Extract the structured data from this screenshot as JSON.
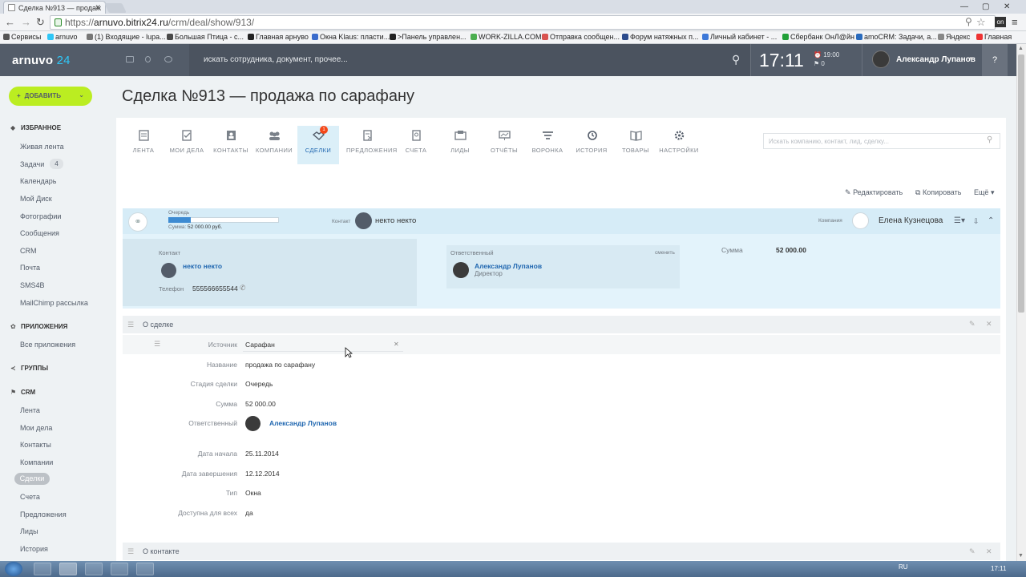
{
  "browser": {
    "tab_title": "Сделка №913 — продаж",
    "url_scheme": "https://",
    "url_host": "arnuvo.bitrix24.ru",
    "url_path": "/crm/deal/show/913/",
    "ext_label": "on",
    "bookmarks": [
      {
        "label": "Сервисы",
        "color": "#555555"
      },
      {
        "label": "arnuvo",
        "color": "#2fc7f7"
      },
      {
        "label": "(1) Входящие - lupa...",
        "color": "#777777"
      },
      {
        "label": "Большая Птица - с...",
        "color": "#4a4a4a"
      },
      {
        "label": "Главная арнуво",
        "color": "#222222"
      },
      {
        "label": "Окна Klaus: пласти...",
        "color": "#3b6ccc"
      },
      {
        "label": ">Панель управлен...",
        "color": "#222222"
      },
      {
        "label": "WORK-ZILLA.COM",
        "color": "#4caf50"
      },
      {
        "label": "Отправка сообщен...",
        "color": "#d9534f"
      },
      {
        "label": "Форум натяжных п...",
        "color": "#2b4b8c"
      },
      {
        "label": "Личный кабинет - ...",
        "color": "#3c78d8"
      },
      {
        "label": "Сбербанк ОнЛ@йн",
        "color": "#21a038"
      },
      {
        "label": "amoCRM: Задачи, а...",
        "color": "#2a6bbd"
      },
      {
        "label": "Яндекс",
        "color": "#888888"
      },
      {
        "label": "Главная",
        "color": "#e33"
      }
    ]
  },
  "header": {
    "logo_text": "arnuvo",
    "logo_num": "24",
    "search_placeholder": "искать сотрудника, документ, прочее...",
    "clock": "17:11",
    "alarm_time": "19:00",
    "alarm_count": "0",
    "user_name": "Александр Лупанов",
    "help": "?"
  },
  "sidebar": {
    "add_button": "ДОБАВИТЬ",
    "favorites": "ИЗБРАННОЕ",
    "fav_items": [
      "Живая лента",
      "Задачи",
      "Календарь",
      "Мой Диск",
      "Фотографии",
      "Сообщения",
      "CRM",
      "Почта",
      "SMS4B",
      "MailChimp рассылка"
    ],
    "tasks_count": "4",
    "apps": "ПРИЛОЖЕНИЯ",
    "all_apps": "Все приложения",
    "groups": "ГРУППЫ",
    "crm": "CRM",
    "crm_items": [
      "Лента",
      "Мои дела",
      "Контакты",
      "Компании",
      "Сделки",
      "Счета",
      "Предложения",
      "Лиды",
      "История"
    ]
  },
  "page": {
    "title": "Сделка №913 — продажа по сарафану"
  },
  "crm_tabs": [
    {
      "label": "ЛЕНТА",
      "icon": "feed-icon"
    },
    {
      "label": "МОИ ДЕЛА",
      "icon": "tasks-icon"
    },
    {
      "label": "КОНТАКТЫ",
      "icon": "contact-icon"
    },
    {
      "label": "КОМПАНИИ",
      "icon": "company-icon"
    },
    {
      "label": "СДЕЛКИ",
      "icon": "handshake-icon",
      "badge": "1"
    },
    {
      "label": "ПРЕДЛОЖЕНИЯ",
      "icon": "offer-icon"
    },
    {
      "label": "СЧЕТА",
      "icon": "invoice-icon"
    },
    {
      "label": "ЛИДЫ",
      "icon": "leads-icon"
    },
    {
      "label": "ОТЧЁТЫ",
      "icon": "reports-icon"
    },
    {
      "label": "ВОРОНКА",
      "icon": "funnel-icon"
    },
    {
      "label": "ИСТОРИЯ",
      "icon": "history-icon"
    },
    {
      "label": "ТОВАРЫ",
      "icon": "book-icon"
    },
    {
      "label": "НАСТРОЙКИ",
      "icon": "gear-icon"
    }
  ],
  "crm_search_placeholder": "Искать компанию, контакт, лид, сделку...",
  "actions": {
    "edit": "Редактировать",
    "copy": "Копировать",
    "more": "Ещё"
  },
  "deal": {
    "stage_label": "Очередь",
    "stage_progress": 0.2,
    "sum_label": "Сумма:",
    "sum_value": "52 000.00 руб.",
    "contact_label": "Контакт",
    "contact_name": "некто некто",
    "company_label": "Компания",
    "company_name": "Елена Кузнецова",
    "contact_box_label": "Контакт",
    "phone_label": "Телефон",
    "phone_value": "555566655544",
    "resp_label": "Ответственный",
    "resp_change": "сменить",
    "resp_name": "Александр Лупанов",
    "resp_position": "Директор",
    "sum_label2": "Сумма",
    "sum_value2": "52 000.00"
  },
  "about": {
    "title": "О сделке",
    "fields": [
      {
        "label": "Источник",
        "value": "Сарафан"
      },
      {
        "label": "Название",
        "value": "продажа по сарафану"
      },
      {
        "label": "Стадия сделки",
        "value": "Очередь"
      },
      {
        "label": "Сумма",
        "value": "52 000.00"
      },
      {
        "label": "Ответственный",
        "value": "Александр Лупанов"
      },
      {
        "label": "Дата начала",
        "value": "25.11.2014"
      },
      {
        "label": "Дата завершения",
        "value": "12.12.2014"
      },
      {
        "label": "Тип",
        "value": "Окна"
      },
      {
        "label": "Доступна для всех",
        "value": "да"
      }
    ]
  },
  "contact_section": {
    "title": "О контакте"
  },
  "taskbar": {
    "lang": "RU",
    "time": "17:11"
  }
}
